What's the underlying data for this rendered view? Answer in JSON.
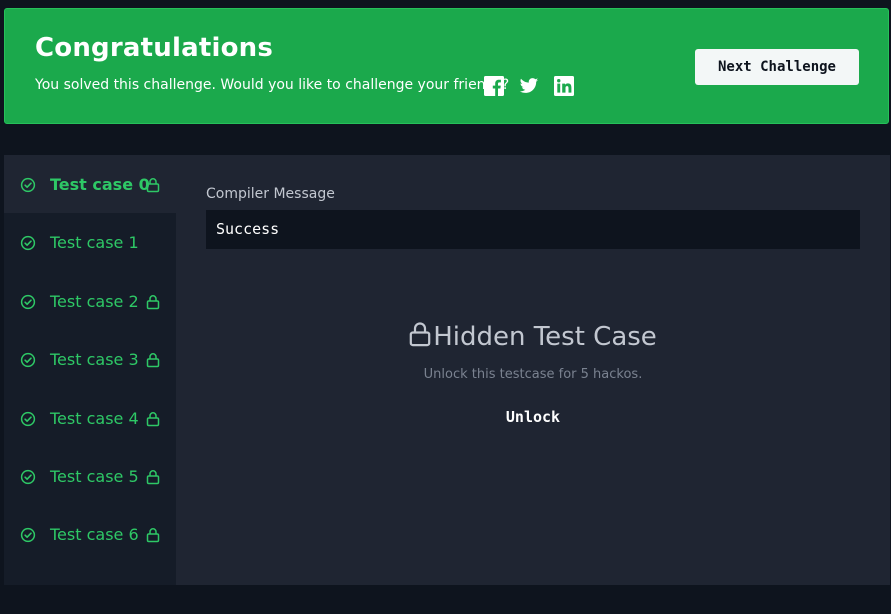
{
  "banner": {
    "title": "Congratulations",
    "message": "You solved this challenge. Would you like to challenge your friends?",
    "social_icons": [
      "facebook-icon",
      "twitter-icon",
      "linkedin-icon"
    ],
    "next_button_label": "Next Challenge",
    "background_color": "#1ba94c"
  },
  "test_cases": [
    {
      "label": "Test case 0",
      "status_icon": "check-circle-icon",
      "locked": true,
      "active": true
    },
    {
      "label": "Test case 1",
      "status_icon": "check-circle-icon",
      "locked": false,
      "active": false
    },
    {
      "label": "Test case 2",
      "status_icon": "check-circle-icon",
      "locked": true,
      "active": false
    },
    {
      "label": "Test case 3",
      "status_icon": "check-circle-icon",
      "locked": true,
      "active": false
    },
    {
      "label": "Test case 4",
      "status_icon": "check-circle-icon",
      "locked": true,
      "active": false
    },
    {
      "label": "Test case 5",
      "status_icon": "check-circle-icon",
      "locked": true,
      "active": false
    },
    {
      "label": "Test case 6",
      "status_icon": "check-circle-icon",
      "locked": true,
      "active": false
    }
  ],
  "compiler": {
    "label": "Compiler Message",
    "message": "Success"
  },
  "hidden": {
    "title": "Hidden Test Case",
    "subtitle": "Unlock this testcase for 5 hackos.",
    "unlock_label": "Unlock"
  },
  "colors": {
    "accent_green": "#2ec866",
    "page_background": "#0e141e",
    "panel_background": "#1f2532",
    "sidebar_background": "#151c28"
  }
}
